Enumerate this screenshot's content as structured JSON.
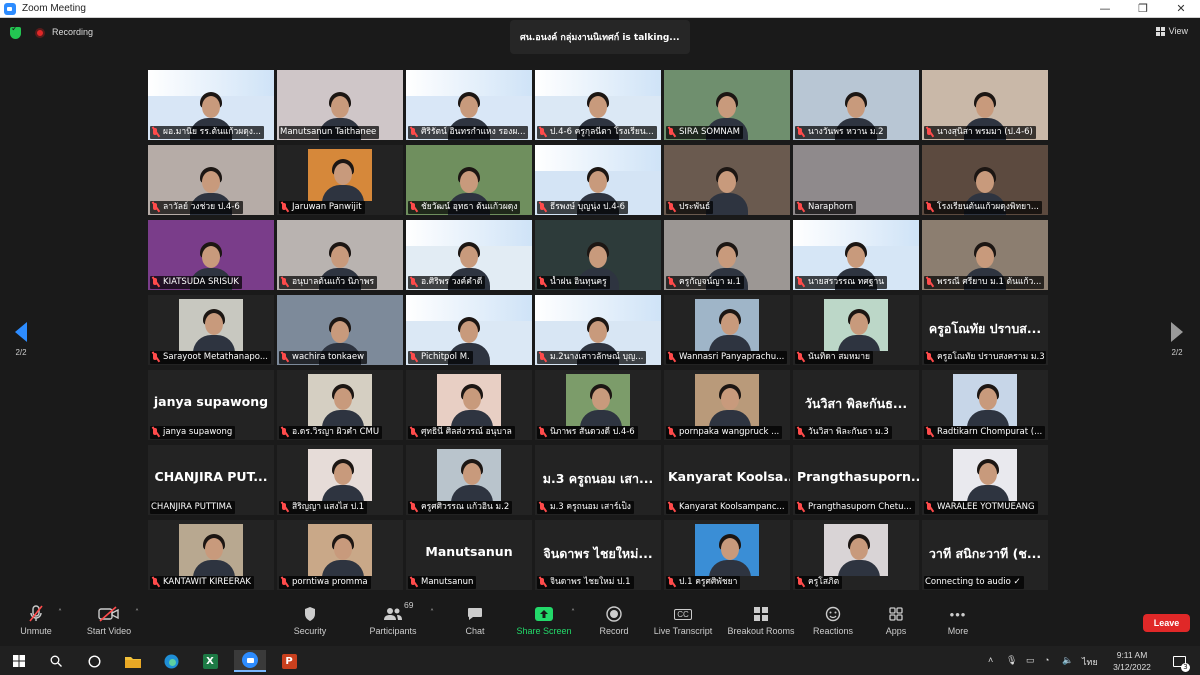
{
  "window": {
    "title": "Zoom Meeting",
    "minimize": "—",
    "maximize": "❐",
    "close": "✕"
  },
  "status": {
    "recording": "Recording",
    "talking": "ศน.อนงค์ กลุ่มงานนิเทศก์ is talking...",
    "view": "View"
  },
  "pager": {
    "left": "2/2",
    "right": "2/2"
  },
  "tiles": [
    {
      "label": "ผอ.มานิย รร.ต้นแก้วผดุง...",
      "muted": true,
      "kind": "banner",
      "bg": "#d8e6f6"
    },
    {
      "label": "Manutsanun Taithanee",
      "muted": false,
      "kind": "video",
      "bg": "#cfc6c8"
    },
    {
      "label": "ศิริรัตน์ อินทรกำแหง รองผ...",
      "muted": true,
      "kind": "banner",
      "bg": "#d9e7f7"
    },
    {
      "label": "ป.4-6 ครูกุลนีตา โรงเรียน...",
      "muted": true,
      "kind": "banner",
      "bg": "#dbe8f5"
    },
    {
      "label": "SIRA SOMNAM",
      "muted": true,
      "kind": "video",
      "bg": "#6f8f6e"
    },
    {
      "label": "นางวันพร หวาน ม.2",
      "muted": true,
      "kind": "video",
      "bg": "#b8c6d4"
    },
    {
      "label": "นางสุนิสา พรมมา (ป.4-6)",
      "muted": true,
      "kind": "video",
      "bg": "#c9b8a8"
    },
    {
      "label": "ลาวัลย์ วงช่วย ป.4-6",
      "muted": true,
      "kind": "video",
      "bg": "#b6aca7"
    },
    {
      "label": "Jaruwan Panwijit",
      "muted": true,
      "kind": "photo",
      "bg": "#d6883a"
    },
    {
      "label": "ชัยวัฒน์ อุทธา ต้นแก้วผดุง",
      "muted": true,
      "kind": "video",
      "bg": "#6f8f5e"
    },
    {
      "label": "ธีรพงษ์ บุญนุ่ง ป.4-6",
      "muted": true,
      "kind": "banner",
      "bg": "#d4e4f5"
    },
    {
      "label": "ประพันธ์",
      "muted": true,
      "kind": "video",
      "bg": "#6a5a4f"
    },
    {
      "label": "Naraphorn",
      "muted": true,
      "kind": "empty",
      "bg": "#8f8a8c"
    },
    {
      "label": "โรงเรียนต้นแก้วผดุงพิทยา...",
      "muted": true,
      "kind": "video",
      "bg": "#5c4a3f"
    },
    {
      "label": "KIATSUDA SRISUK",
      "muted": true,
      "kind": "video",
      "bg": "#7a3d8a"
    },
    {
      "label": "อนุบาลต้นแก้ว นิภาพร",
      "muted": true,
      "kind": "video",
      "bg": "#b9b3b0"
    },
    {
      "label": "อ.ศิริพร วงค์คำดี",
      "muted": true,
      "kind": "banner",
      "bg": "#e2ecf4"
    },
    {
      "label": "น้ำฝน อินทุนครู",
      "muted": true,
      "kind": "video",
      "bg": "#2d3b3a"
    },
    {
      "label": "ครูกัญจน์ญา ม.1",
      "muted": true,
      "kind": "video",
      "bg": "#9c9794"
    },
    {
      "label": "นายสรวรรณ ทศฐาน",
      "muted": true,
      "kind": "banner",
      "bg": "#d6e6f6"
    },
    {
      "label": "พรรณี ศรียาบ ม.1 ต้นแก้ว...",
      "muted": true,
      "kind": "video",
      "bg": "#8c7e70"
    },
    {
      "label": "Sarayoot Metathanapo...",
      "muted": true,
      "kind": "photo",
      "bg": "#c8c8c0"
    },
    {
      "label": "wachira tonkaew",
      "muted": true,
      "kind": "video",
      "bg": "#7d8a9a"
    },
    {
      "label": "Pichitpol M.",
      "muted": true,
      "kind": "banner",
      "bg": "#dbe8f5"
    },
    {
      "label": "ม.2นางเสาวลักษณ์ บุญ...",
      "muted": true,
      "kind": "banner",
      "bg": "#d8e6f4"
    },
    {
      "label": "Wannasri Panyaprachu...",
      "muted": true,
      "kind": "photo",
      "bg": "#9fb5c8"
    },
    {
      "label": "นันทิดา สมหมาย",
      "muted": true,
      "kind": "photo",
      "bg": "#bcd7c8"
    },
    {
      "label": "ครูอโณทัย ปราบสงคราม ม.3",
      "muted": true,
      "kind": "name",
      "big": "ครูอโณทัย ปราบส..."
    },
    {
      "label": "janya supawong",
      "muted": true,
      "kind": "name",
      "big": "janya supawong"
    },
    {
      "label": "อ.ดร.วิรญา ผิวคำ CMU",
      "muted": true,
      "kind": "photo",
      "bg": "#d5cfc2"
    },
    {
      "label": "ศุทธินี ศิลส่งวรณ์ อนุบาล",
      "muted": true,
      "kind": "photo",
      "bg": "#e8cfc4"
    },
    {
      "label": "นิภาพร สันดวงดี ป.4-6",
      "muted": true,
      "kind": "photo",
      "bg": "#7c9c6a"
    },
    {
      "label": "pornpaka wangpruck ...",
      "muted": true,
      "kind": "photo",
      "bg": "#b99a7a"
    },
    {
      "label": "วันวิสา พิละกันธา ม.3",
      "muted": true,
      "kind": "name",
      "big": "วันวิสา  พิละกันธ..."
    },
    {
      "label": "Radtikarn Chompurat (...",
      "muted": true,
      "kind": "photo",
      "bg": "#c7d6e8"
    },
    {
      "label": "CHANJIRA PUTTIMA",
      "muted": false,
      "kind": "name",
      "big": "CHANJIRA  PUT..."
    },
    {
      "label": "สิริญญา แสงไส ป.1",
      "muted": true,
      "kind": "photo",
      "bg": "#e6dcd8"
    },
    {
      "label": "ครูศศิวรรณ แก้วอิน ม.2",
      "muted": true,
      "kind": "photo",
      "bg": "#b9c4cc"
    },
    {
      "label": "ม.3 ครูถนอม เสาร์เป็ง",
      "muted": true,
      "kind": "name",
      "big": "ม.3 ครูถนอม เสา..."
    },
    {
      "label": "Kanyarat Koolsampanc...",
      "muted": true,
      "kind": "name",
      "big": "Kanyarat  Koolsa..."
    },
    {
      "label": "Prangthasuporn Chetu...",
      "muted": true,
      "kind": "name",
      "big": "Prangthasuporn..."
    },
    {
      "label": "WARALEE YOTMUEANG",
      "muted": true,
      "kind": "photo",
      "bg": "#e9e9ee"
    },
    {
      "label": "KANTAWIT KIREERAK",
      "muted": true,
      "kind": "photo",
      "bg": "#b8a890"
    },
    {
      "label": "porntiwa promma",
      "muted": true,
      "kind": "photo",
      "bg": "#c9a888"
    },
    {
      "label": "Manutsanun",
      "muted": true,
      "kind": "name",
      "big": "Manutsanun"
    },
    {
      "label": "จินดาพร ไชยใหม่ ป.1",
      "muted": true,
      "kind": "name",
      "big": "จินดาพร  ไชยใหม่..."
    },
    {
      "label": "ป.1 ครูศศิพัชยา",
      "muted": true,
      "kind": "photo",
      "bg": "#3a8ed6"
    },
    {
      "label": "ครูโสภิต",
      "muted": true,
      "kind": "photo",
      "bg": "#d9d4d6"
    },
    {
      "label": "Connecting to audio ✓",
      "muted": false,
      "kind": "name",
      "big": "วาที สนิกะวาที (ช..."
    }
  ],
  "toolbar": {
    "unmute": "Unmute",
    "start_video": "Start Video",
    "security": "Security",
    "participants": "Participants",
    "participants_count": "69",
    "chat": "Chat",
    "share_screen": "Share Screen",
    "record": "Record",
    "live_transcript": "Live Transcript",
    "breakout_rooms": "Breakout Rooms",
    "reactions": "Reactions",
    "apps": "Apps",
    "more": "More",
    "leave": "Leave",
    "cc": "CC"
  },
  "taskbar": {
    "lang": "ไทย",
    "time": "9:11 AM",
    "date": "3/12/2022",
    "notif_count": "3",
    "excel": "X",
    "ppt": "P"
  },
  "colors": {
    "accent": "#2d8cff",
    "mute": "#ff4b4b",
    "leave": "#e02828",
    "share": "#23d96a"
  }
}
